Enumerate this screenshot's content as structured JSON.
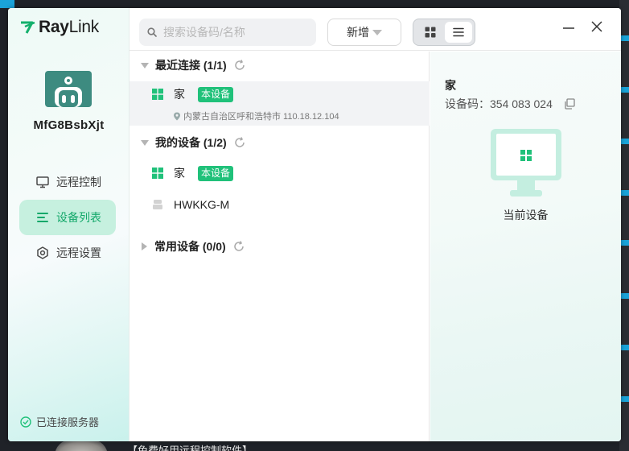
{
  "app": {
    "logo_part1": "Ray",
    "logo_part2": "Link",
    "username": "MfG8BsbXjt"
  },
  "sidebar": {
    "items": [
      {
        "label": "远程控制",
        "icon": "monitor-icon",
        "active": false
      },
      {
        "label": "设备列表",
        "icon": "list-icon",
        "active": true
      },
      {
        "label": "远程设置",
        "icon": "settings-hexagon-icon",
        "active": false
      }
    ],
    "status": "已连接服务器"
  },
  "toolbar": {
    "search_placeholder": "搜索设备码/名称",
    "add_label": "新增"
  },
  "groups": {
    "recent": {
      "title": "最近连接 (1/1)"
    },
    "mine": {
      "title": "我的设备 (1/2)"
    },
    "common": {
      "title": "常用设备 (0/0)"
    }
  },
  "devices": {
    "recent": [
      {
        "name": "家",
        "badge": "本设备",
        "location": "内蒙古自治区呼和浩特市 110.18.12.104"
      }
    ],
    "mine": [
      {
        "name": "家",
        "badge": "本设备"
      },
      {
        "name": "HWKKG-M"
      }
    ]
  },
  "detail": {
    "name": "家",
    "code": "设备码：354 083 024",
    "caption": "当前设备"
  },
  "background": {
    "bottom_text": "【免费好用远程控制软件】"
  },
  "colors": {
    "accent": "#20c17a",
    "active_nav_bg": "#c6f0df",
    "avatar": "#3d8b80"
  }
}
